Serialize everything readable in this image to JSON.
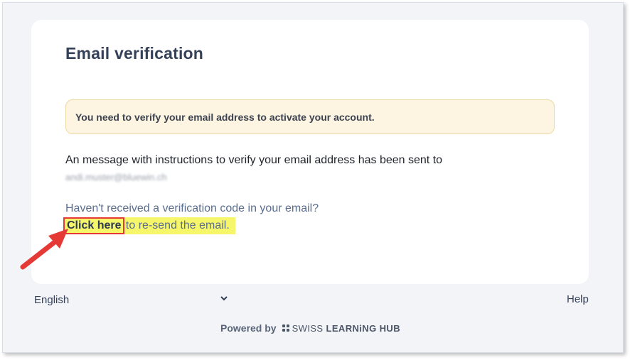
{
  "card": {
    "title": "Email verification",
    "alert_text": "You need to verify your email address to activate your account.",
    "message_text": "An message with instructions to verify your email address has been sent to",
    "email": "andi.muster@bluewin.ch",
    "question_text": "Haven't received a verification code in your email?",
    "resend_link": "Click here",
    "resend_suffix": " to re-send the email."
  },
  "footer": {
    "language": "English",
    "help": "Help",
    "powered_by": "Powered by",
    "brand_light": "SWISS ",
    "brand_bold": "LEARNiNG HUB"
  },
  "colors": {
    "highlight": "#f6f66a",
    "annotation": "#e53935",
    "alert_bg": "#fdf5e1"
  },
  "icons": {
    "language_select": "chevron-down-icon",
    "annotation": "arrow-icon",
    "brand": "logo-dots-icon"
  }
}
